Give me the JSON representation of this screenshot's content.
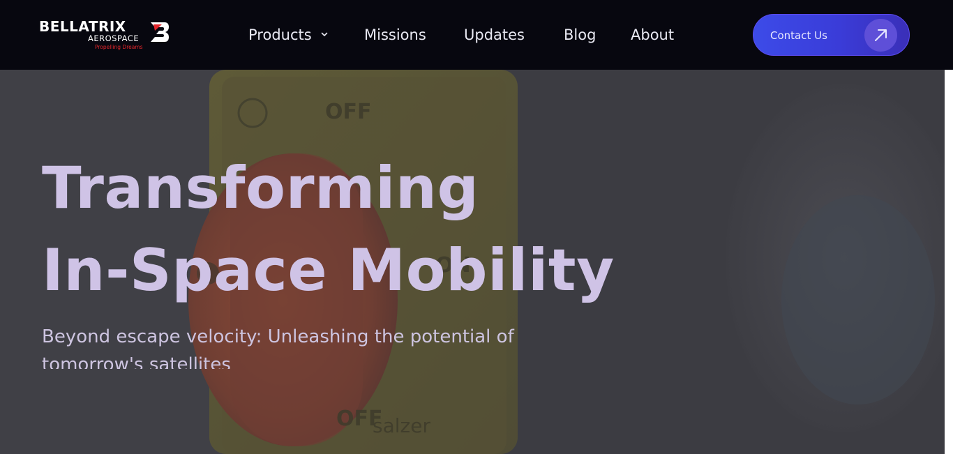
{
  "brand": {
    "name": "BELLATRIX",
    "sub": "AEROSPACE",
    "tagline": "Propelling Dreams"
  },
  "nav": {
    "items": [
      {
        "label": "Products",
        "has_dropdown": true
      },
      {
        "label": "Missions"
      },
      {
        "label": "Updates"
      },
      {
        "label": "Blog"
      },
      {
        "label": "About"
      }
    ]
  },
  "contact": {
    "label": "Contact Us",
    "icon": "arrow-up-right-icon"
  },
  "hero": {
    "title_line1": "Transforming",
    "title_line2": "In-Space Mobility",
    "subtitle": "Beyond escape velocity: Unleashing the potential of tomorrow's satellites",
    "background_labels": {
      "off_top": "OFF",
      "on": "ON",
      "off_bottom": "OFF",
      "brand": "salzer"
    }
  },
  "colors": {
    "navbar_bg": "#07070f",
    "accent": "#3c4be8",
    "hero_text": "#cfc3e6",
    "logo_red": "#e3262b"
  }
}
